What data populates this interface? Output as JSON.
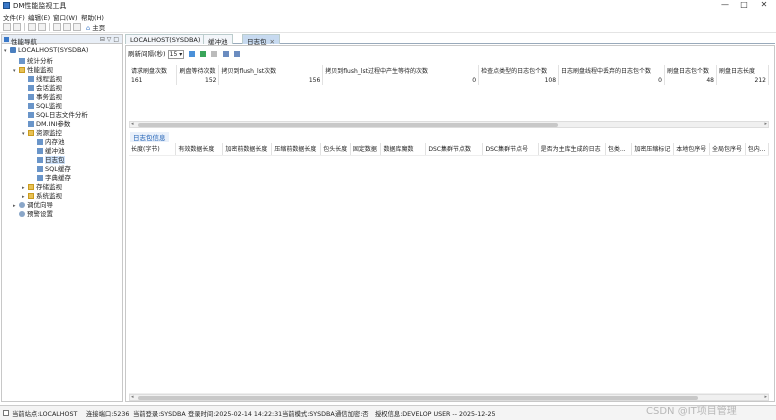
{
  "window": {
    "title": "DM性能监视工具",
    "controls": [
      "—",
      "□",
      "✕"
    ]
  },
  "menu": [
    "文件(F)",
    "编辑(E)",
    "窗口(W)",
    "帮助(H)"
  ],
  "toolbar": {
    "home_label": "主页"
  },
  "nav": {
    "panel_title": "性能导航",
    "panel_buttons": "⊟ ▽ □",
    "tree": [
      {
        "label": "LOCALHOST(SYSDBA)",
        "level": 0,
        "toggle": "▾",
        "icon": "database-icon"
      },
      {
        "label": "统计分析",
        "level": 1,
        "toggle": "",
        "icon": "chart-icon"
      },
      {
        "label": "性能监视",
        "level": 1,
        "toggle": "▾",
        "icon": "folder-icon"
      },
      {
        "label": "线程监视",
        "level": 2,
        "toggle": "",
        "icon": "thread-icon"
      },
      {
        "label": "会话监视",
        "level": 2,
        "toggle": "",
        "icon": "session-icon"
      },
      {
        "label": "事务监视",
        "level": 2,
        "toggle": "",
        "icon": "transaction-icon"
      },
      {
        "label": "SQL监视",
        "level": 2,
        "toggle": "",
        "icon": "sql-icon"
      },
      {
        "label": "SQL日志文件分析",
        "level": 2,
        "toggle": "",
        "icon": "log-analysis-icon"
      },
      {
        "label": "DM.INI参数",
        "level": 2,
        "toggle": "",
        "icon": "ini-icon"
      },
      {
        "label": "资源监控",
        "level": 2,
        "toggle": "▾",
        "icon": "folder-icon"
      },
      {
        "label": "内存池",
        "level": 3,
        "toggle": "",
        "icon": "memory-icon"
      },
      {
        "label": "缓冲池",
        "level": 3,
        "toggle": "",
        "icon": "buffer-icon"
      },
      {
        "label": "日志包",
        "level": 3,
        "toggle": "",
        "icon": "log-icon",
        "selected": true
      },
      {
        "label": "SQL缓存",
        "level": 3,
        "toggle": "",
        "icon": "cache-icon"
      },
      {
        "label": "字典缓存",
        "level": 3,
        "toggle": "",
        "icon": "dictionary-icon"
      },
      {
        "label": "存储监视",
        "level": 2,
        "toggle": "▸",
        "icon": "folder-icon"
      },
      {
        "label": "系统监视",
        "level": 2,
        "toggle": "▸",
        "icon": "folder-icon"
      },
      {
        "label": "调优向导",
        "level": 1,
        "toggle": "▸",
        "icon": "wizard-icon"
      },
      {
        "label": "预警设置",
        "level": 1,
        "toggle": "",
        "icon": "alert-icon"
      }
    ]
  },
  "tabs": [
    {
      "label": "LOCALHOST(SYSDBA)",
      "active": false,
      "closable": false
    },
    {
      "label": "缓冲池",
      "active": false,
      "closable": false
    },
    {
      "label": "日志包",
      "active": true,
      "closable": true
    }
  ],
  "refresh": {
    "label": "刷新间隔(秒)",
    "value": "15"
  },
  "stats": {
    "headers": [
      "请求刷盘次数",
      "刷盘等待次数",
      "拷贝到flush_lst次数",
      "拷贝到flush_lst过程中产生等待的次数",
      "检查点类型的日志包个数",
      "日志刷盘线程中丢弃的日志包个数",
      "刷盘日志包个数",
      "刷盘日志长度"
    ],
    "row": [
      "161",
      "152",
      "156",
      "0",
      "108",
      "0",
      "48",
      "212"
    ]
  },
  "detail": {
    "section_title": "日志包信息",
    "headers": [
      "长度(字节)",
      "有效数据长度",
      "加密前数据长度",
      "压缩前数据长度",
      "包头长度",
      "固定数据",
      "数据库魔数",
      "DSC集群节点数",
      "DSC集群节点号",
      "是否为主库生成的日志",
      "包类...",
      "加密压缩标记",
      "本地包序号",
      "全局包序号",
      "包内..."
    ]
  },
  "status": {
    "items": [
      "当前站点:LOCALHOST",
      "连接端口:5236",
      "当前登录:SYSDBA",
      "登录时间:2025-02-14 14:22:31",
      "当前模式:SYSDBA",
      "通信加密:否",
      "授权信息:DEVELOP USER -- 2025-12-25"
    ]
  },
  "watermark": "CSDN @IT项目管理"
}
